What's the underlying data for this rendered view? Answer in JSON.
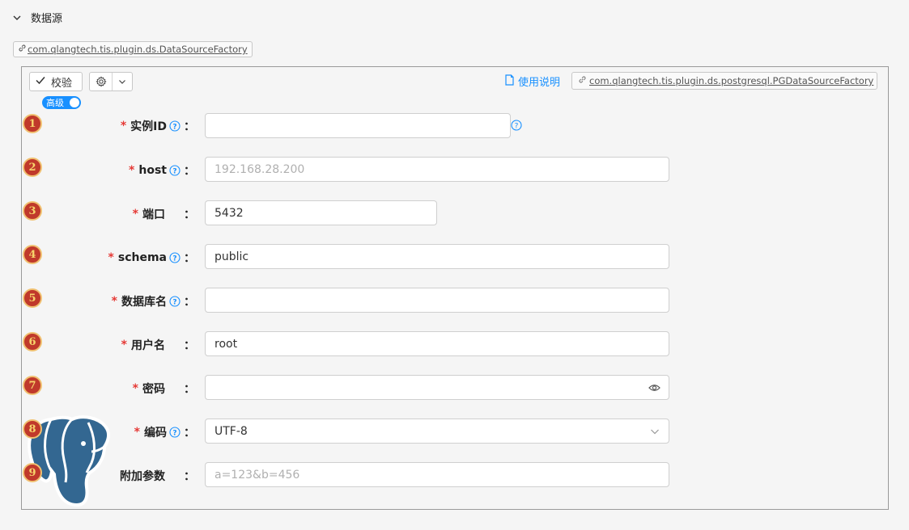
{
  "section": {
    "title": "数据源",
    "icon": "chevron-down-icon"
  },
  "plugin_tag": {
    "text": "com.qlangtech.tis.plugin.ds.DataSourceFactory",
    "icon": "link-icon"
  },
  "toolbar": {
    "verify_label": "校验",
    "verify_icon": "check-icon",
    "settings_icon": "gear-icon",
    "dropdown_icon": "chevron-down-icon",
    "doc_label": "使用说明",
    "doc_icon": "document-icon",
    "impl_tag": "com.qlangtech.tis.plugin.ds.postgresql.PGDataSourceFactory"
  },
  "advanced_toggle": {
    "label": "高级",
    "on": true
  },
  "colors": {
    "accent": "#1890ff",
    "required": "#e53935",
    "badge": "#c0392b",
    "badge_text": "#f6d36b",
    "elephant": "#336791"
  },
  "form": {
    "colon": "：",
    "fields": [
      {
        "badge": "1",
        "label": "实例ID",
        "required": true,
        "help": true,
        "value": "",
        "placeholder": ""
      },
      {
        "badge": "2",
        "label": "host",
        "required": true,
        "help": true,
        "value": "",
        "placeholder": "192.168.28.200"
      },
      {
        "badge": "3",
        "label": "端口",
        "required": true,
        "help": false,
        "value": "5432",
        "placeholder": ""
      },
      {
        "badge": "4",
        "label": "schema",
        "required": true,
        "help": true,
        "value": "public",
        "placeholder": ""
      },
      {
        "badge": "5",
        "label": "数据库名",
        "required": true,
        "help": true,
        "value": "",
        "placeholder": ""
      },
      {
        "badge": "6",
        "label": "用户名",
        "required": true,
        "help": false,
        "value": "root",
        "placeholder": ""
      },
      {
        "badge": "7",
        "label": "密码",
        "required": true,
        "help": false,
        "value": "",
        "placeholder": "",
        "icon": "eye-icon"
      },
      {
        "badge": "8",
        "label": "编码",
        "required": true,
        "help": true,
        "value": "UTF-8",
        "placeholder": "",
        "icon": "chevron-down-icon"
      },
      {
        "badge": "9",
        "label": "附加参数",
        "required": false,
        "help": false,
        "value": "",
        "placeholder": "a=123&b=456"
      }
    ]
  }
}
